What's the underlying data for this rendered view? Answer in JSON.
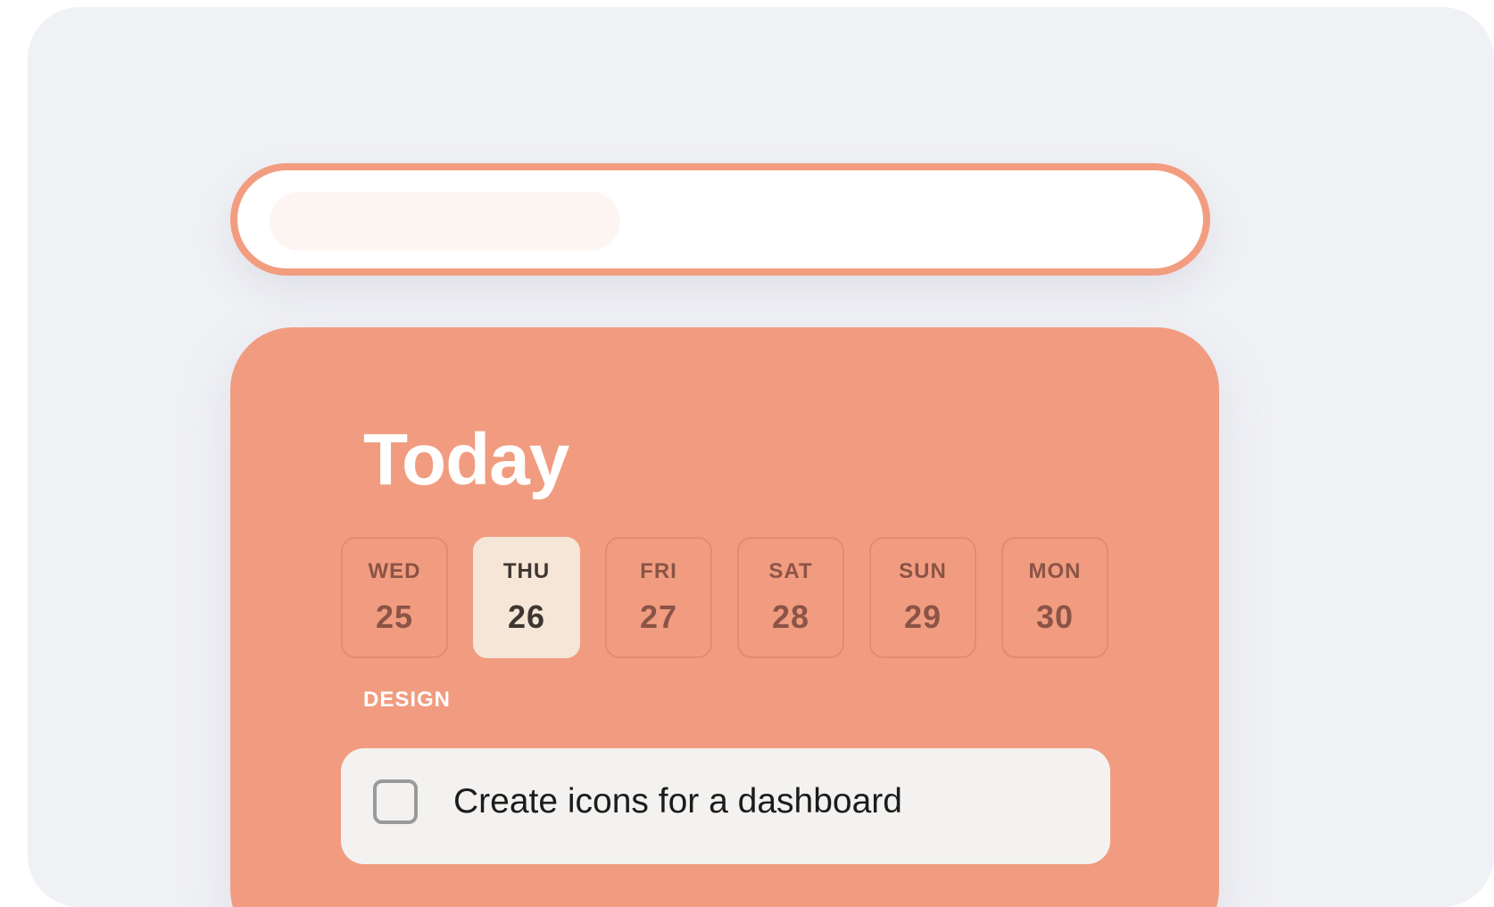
{
  "search": {
    "placeholder_pill": "",
    "accent_color": "#f29d80"
  },
  "today_card": {
    "title": "Today",
    "background_color": "#f19c80",
    "days": [
      {
        "name": "WED",
        "number": "25",
        "selected": false
      },
      {
        "name": "THU",
        "number": "26",
        "selected": true
      },
      {
        "name": "FRI",
        "number": "27",
        "selected": false
      },
      {
        "name": "SAT",
        "number": "28",
        "selected": false
      },
      {
        "name": "SUN",
        "number": "29",
        "selected": false
      },
      {
        "name": "MON",
        "number": "30",
        "selected": false
      }
    ],
    "section_label": "DESIGN",
    "tasks": [
      {
        "text": "Create icons for a dashboard",
        "checked": false,
        "icon": "checkbox-icon"
      }
    ]
  }
}
